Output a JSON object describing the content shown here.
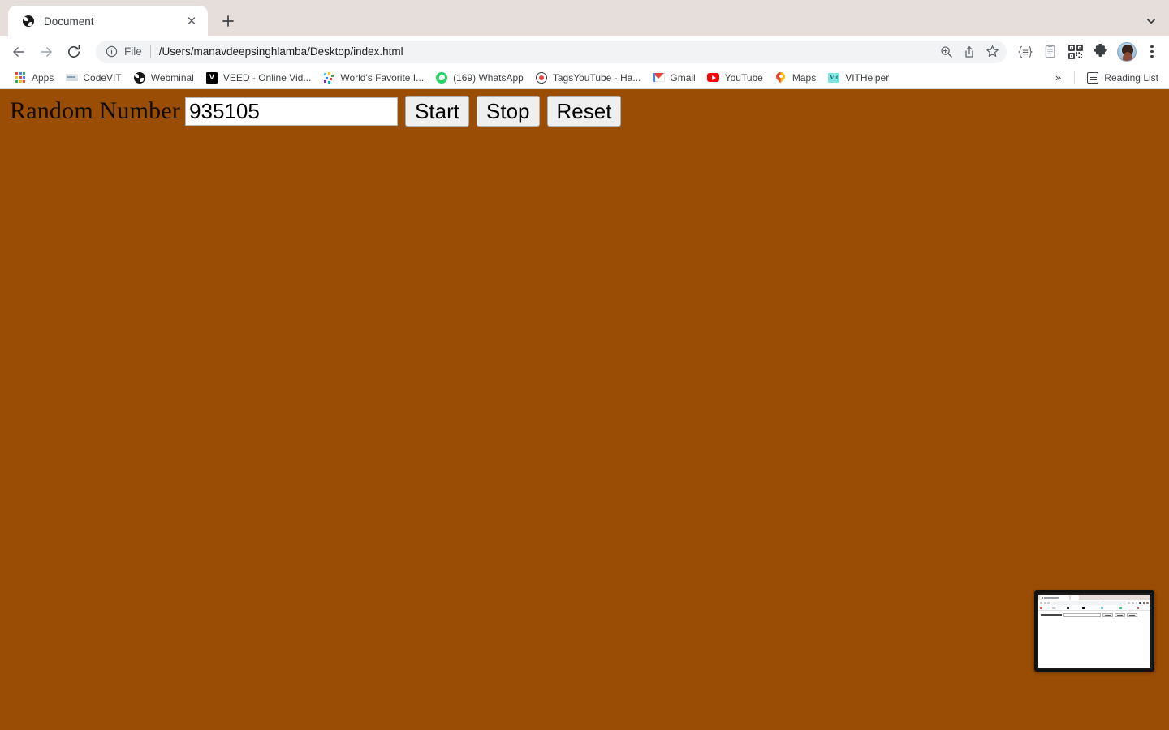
{
  "browser": {
    "tab": {
      "title": "Document",
      "favicon": "globe-icon",
      "close_label": "✕"
    },
    "new_tab_label": "+",
    "tab_search_icon": "chevron-down-icon",
    "nav": {
      "back_label": "←",
      "forward_label": "→",
      "reload_label": "↻"
    },
    "omnibox": {
      "info_icon": "info-circle-icon",
      "scheme_label": "File",
      "url": "/Users/manavdeepsinghlamba/Desktop/index.html",
      "zoom_icon": "zoom-in-icon",
      "share_icon": "share-icon",
      "bookmark_icon": "star-icon"
    },
    "toolbar_icons": [
      {
        "name": "script-braces-icon",
        "glyph": "{≡}"
      },
      {
        "name": "clipboard-icon",
        "glyph": "ὌB"
      },
      {
        "name": "qr-code-icon",
        "glyph": "qr"
      },
      {
        "name": "extensions-puzzle-icon",
        "glyph": "puzzle"
      },
      {
        "name": "profile-avatar",
        "glyph": "avatar"
      },
      {
        "name": "chrome-menu-icon",
        "glyph": "⋮"
      }
    ],
    "bookmarks": [
      {
        "label": "Apps",
        "icon": "apps-grid-icon"
      },
      {
        "label": "CodeVIT",
        "icon": "codevit-icon"
      },
      {
        "label": "Webminal",
        "icon": "globe-icon"
      },
      {
        "label": "VEED - Online Vid...",
        "icon": "veed-icon",
        "mark": "V"
      },
      {
        "label": "World's Favorite I...",
        "icon": "world-favorite-icon"
      },
      {
        "label": "(169) WhatsApp",
        "icon": "whatsapp-icon"
      },
      {
        "label": "TagsYouTube - Ha...",
        "icon": "tags-record-icon"
      },
      {
        "label": "Gmail",
        "icon": "gmail-icon"
      },
      {
        "label": "YouTube",
        "icon": "youtube-icon"
      },
      {
        "label": "Maps",
        "icon": "google-maps-pin-icon"
      },
      {
        "label": "VITHelper",
        "icon": "vithelper-icon",
        "mark": "Vit"
      }
    ],
    "bookmarks_overflow_label": "»",
    "reading_list": {
      "label": "Reading List",
      "icon": "reading-list-icon"
    }
  },
  "page": {
    "background_color": "#9a4d04",
    "heading_label": "Random Number",
    "number_input": {
      "value": "935105",
      "placeholder": ""
    },
    "buttons": [
      {
        "label": "Start",
        "name": "start-button"
      },
      {
        "label": "Stop",
        "name": "stop-button"
      },
      {
        "label": "Reset",
        "name": "reset-button"
      }
    ]
  },
  "preview_thumbnail": {
    "description": "screen-share preview of the browser window"
  },
  "colors": {
    "page_background": "#9a4d04",
    "button_face": "#efefef",
    "tabstrip": "#e6dedb",
    "omnibox": "#f1f3f4"
  }
}
